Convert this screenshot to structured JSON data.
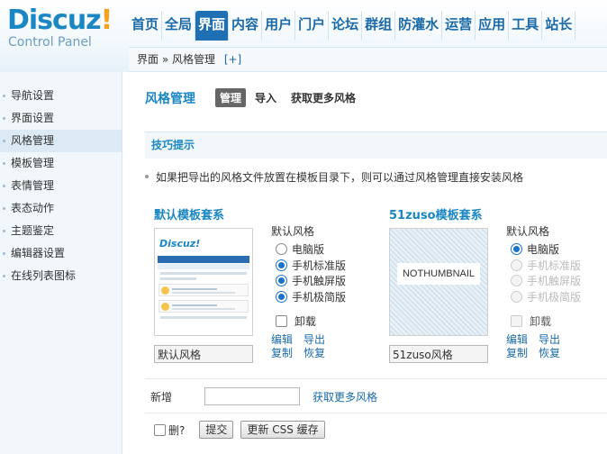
{
  "header": {
    "logo_text": "Discuz",
    "logo_bang": "!",
    "logo_sub": "Control Panel",
    "nav": [
      "首页",
      "全局",
      "界面",
      "内容",
      "用户",
      "门户",
      "论坛",
      "群组",
      "防灌水",
      "运营",
      "应用",
      "工具",
      "站长"
    ],
    "active_nav": "界面",
    "breadcrumb": "界面 » 风格管理",
    "breadcrumb_add": "[+]"
  },
  "sidebar": {
    "items": [
      "导航设置",
      "界面设置",
      "风格管理",
      "模板管理",
      "表情管理",
      "表态动作",
      "主题鉴定",
      "编辑器设置",
      "在线列表图标"
    ],
    "active": "风格管理"
  },
  "main": {
    "title": "风格管理",
    "tabs": [
      "管理",
      "导入",
      "获取更多风格"
    ],
    "active_tab": "管理",
    "tips_title": "技巧提示",
    "tip": "如果把导出的风格文件放置在模板目录下，则可以通过风格管理直接安装风格",
    "default_set": {
      "title": "默认模板套系",
      "name_value": "默认风格",
      "thumb_logo": "Discuz!",
      "option_label": "默认风格",
      "options": [
        {
          "label": "电脑版",
          "checked": false,
          "disabled": false
        },
        {
          "label": "手机标准版",
          "checked": true,
          "disabled": false
        },
        {
          "label": "手机触屏版",
          "checked": true,
          "disabled": false
        },
        {
          "label": "手机极简版",
          "checked": true,
          "disabled": false
        }
      ],
      "uninstall": "卸载",
      "links": [
        "编辑",
        "导出",
        "复制",
        "恢复"
      ]
    },
    "zuso_set": {
      "title": "51zuso模板套系",
      "name_value": "51zuso风格",
      "thumb_text": "NOTHUMBNAIL",
      "option_label": "默认风格",
      "options": [
        {
          "label": "电脑版",
          "checked": true,
          "disabled": false
        },
        {
          "label": "手机标准版",
          "checked": false,
          "disabled": true
        },
        {
          "label": "手机触屏版",
          "checked": false,
          "disabled": true
        },
        {
          "label": "手机极简版",
          "checked": false,
          "disabled": true
        }
      ],
      "uninstall": "卸载",
      "links": [
        "编辑",
        "导出",
        "复制",
        "恢复"
      ]
    },
    "add_label": "新增",
    "add_link": "获取更多风格",
    "delete_label": "删?",
    "submit_label": "提交",
    "refresh_css_label": "更新 CSS 缓存"
  }
}
